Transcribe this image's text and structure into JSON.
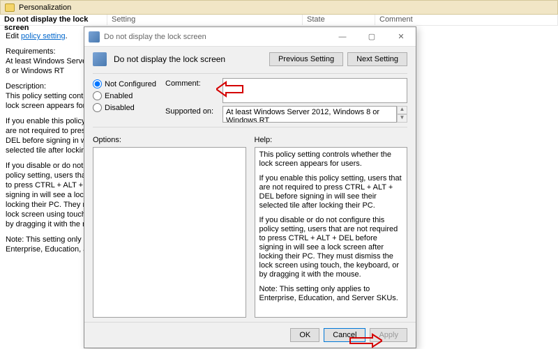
{
  "bg": {
    "category": "Personalization",
    "cols": {
      "name": "Do not display the lock screen",
      "setting": "Setting",
      "state": "State",
      "comment": "Comment"
    },
    "edit_prefix": "Edit ",
    "edit_link": "policy setting",
    "requirements_label": "Requirements:",
    "requirements_text": "At least Windows Server 2012, Windows 8 or Windows RT",
    "description_label": "Description:",
    "desc1": "This policy setting controls whether the lock screen appears for users.",
    "desc2": "If you enable this policy setting, users that are not required to press CTRL + ALT + DEL before signing in will see their selected tile after locking their PC.",
    "desc3": "If you disable or do not configure this policy setting, users that are not required to press CTRL + ALT + DEL before signing in will see a lock screen after locking their PC. They must dismiss the lock screen using touch, the keyboard, or by dragging it with the mouse.",
    "desc4": "Note: This setting only applies to Enterprise, Education, and Server SKUs."
  },
  "dialog": {
    "title": "Do not display the lock screen",
    "heading": "Do not display the lock screen",
    "prev": "Previous Setting",
    "next": "Next Setting",
    "radios": {
      "not_configured": "Not Configured",
      "enabled": "Enabled",
      "disabled": "Disabled"
    },
    "labels": {
      "comment": "Comment:",
      "supported": "Supported on:",
      "options": "Options:",
      "help": "Help:"
    },
    "supported_text": "At least Windows Server 2012, Windows 8 or Windows RT",
    "help": {
      "p1": "This policy setting controls whether the lock screen appears for users.",
      "p2": "If you enable this policy setting, users that are not required to press CTRL + ALT + DEL before signing in will see their selected tile after locking their PC.",
      "p3": "If you disable or do not configure this policy setting, users that are not required to press CTRL + ALT + DEL before signing in will see a lock screen after locking their PC. They must dismiss the lock screen using touch, the keyboard, or by dragging it with the mouse.",
      "p4": "Note: This setting only applies to Enterprise, Education, and Server SKUs."
    },
    "footer": {
      "ok": "OK",
      "cancel": "Cancel",
      "apply": "Apply"
    }
  }
}
